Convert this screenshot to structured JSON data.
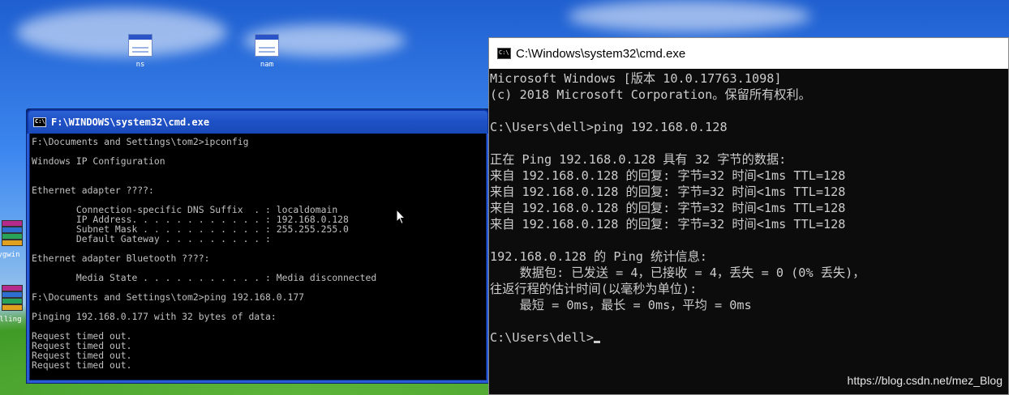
{
  "desktop": {
    "icons": [
      {
        "label": "ns",
        "icon": "console-app-icon"
      },
      {
        "label": "nam",
        "icon": "console-app-icon"
      }
    ],
    "side_icons": [
      {
        "label": "cygwin",
        "icon": "winrar-archive-icon"
      },
      {
        "label": "alling",
        "icon": "winrar-archive-icon"
      }
    ]
  },
  "xp_console": {
    "title": "F:\\WINDOWS\\system32\\cmd.exe",
    "icon": "console-icon",
    "lines": [
      "F:\\Documents and Settings\\tom2>ipconfig",
      "",
      "Windows IP Configuration",
      "",
      "",
      "Ethernet adapter ????:",
      "",
      "        Connection-specific DNS Suffix  . : localdomain",
      "        IP Address. . . . . . . . . . . . : 192.168.0.128",
      "        Subnet Mask . . . . . . . . . . . : 255.255.255.0",
      "        Default Gateway . . . . . . . . . :",
      "",
      "Ethernet adapter Bluetooth ????:",
      "",
      "        Media State . . . . . . . . . . . : Media disconnected",
      "",
      "F:\\Documents and Settings\\tom2>ping 192.168.0.177",
      "",
      "Pinging 192.168.0.177 with 32 bytes of data:",
      "",
      "Request timed out.",
      "Request timed out.",
      "Request timed out.",
      "Request timed out."
    ]
  },
  "win10_console": {
    "title": "C:\\Windows\\system32\\cmd.exe",
    "icon": "console-icon",
    "lines": [
      "Microsoft Windows [版本 10.0.17763.1098]",
      "(c) 2018 Microsoft Corporation。保留所有权利。",
      "",
      "C:\\Users\\dell>ping 192.168.0.128",
      "",
      "正在 Ping 192.168.0.128 具有 32 字节的数据:",
      "来自 192.168.0.128 的回复: 字节=32 时间<1ms TTL=128",
      "来自 192.168.0.128 的回复: 字节=32 时间<1ms TTL=128",
      "来自 192.168.0.128 的回复: 字节=32 时间<1ms TTL=128",
      "来自 192.168.0.128 的回复: 字节=32 时间<1ms TTL=128",
      "",
      "192.168.0.128 的 Ping 统计信息:",
      "    数据包: 已发送 = 4，已接收 = 4，丢失 = 0 (0% 丢失)，",
      "往返行程的估计时间(以毫秒为单位):",
      "    最短 = 0ms，最长 = 0ms，平均 = 0ms",
      "",
      "C:\\Users\\dell>"
    ]
  },
  "watermark": "https://blog.csdn.net/mez_Blog",
  "colors": {
    "xp_titlebar": "#1f51c6",
    "console_bg": "#000000",
    "console_text": "#c0c0c0"
  }
}
